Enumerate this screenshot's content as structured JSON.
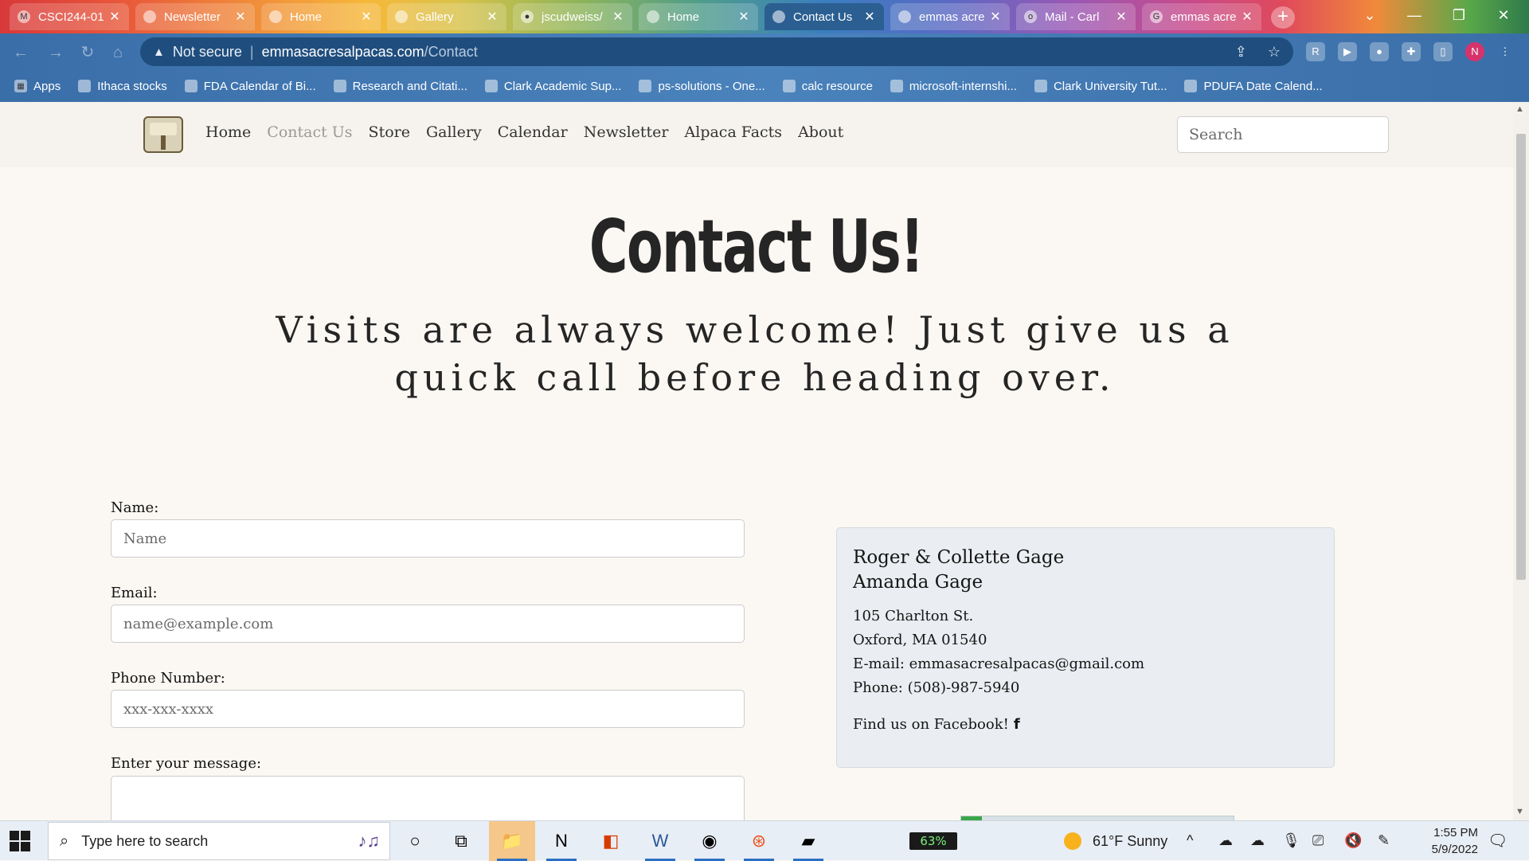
{
  "browser": {
    "tabs": [
      {
        "title": "CSCI244-01",
        "icon": "gmail-icon",
        "active": false
      },
      {
        "title": "Newsletter",
        "icon": "globe-icon",
        "active": false
      },
      {
        "title": "Home",
        "icon": "globe-icon",
        "active": false
      },
      {
        "title": "Gallery",
        "icon": "globe-icon",
        "active": false
      },
      {
        "title": "jscudweiss/",
        "icon": "github-icon",
        "active": false
      },
      {
        "title": "Home",
        "icon": "globe-icon",
        "active": false
      },
      {
        "title": "Contact Us",
        "icon": "globe-icon",
        "active": true
      },
      {
        "title": "emmas acre",
        "icon": "globe-icon",
        "active": false
      },
      {
        "title": "Mail - Carl",
        "icon": "outlook-icon",
        "active": false
      },
      {
        "title": "emmas acre",
        "icon": "google-icon",
        "active": false
      }
    ],
    "address": {
      "security": "Not secure",
      "host": "emmasacresalpacas.com",
      "path": "/Contact"
    },
    "bookmarks": [
      {
        "label": "Apps",
        "icon": "apps-grid-icon"
      },
      {
        "label": "Ithaca stocks",
        "icon": "bookmark-icon"
      },
      {
        "label": "FDA Calendar of Bi...",
        "icon": "bookmark-icon"
      },
      {
        "label": "Research and Citati...",
        "icon": "bookmark-icon"
      },
      {
        "label": "Clark Academic Sup...",
        "icon": "bookmark-icon"
      },
      {
        "label": "ps-solutions - One...",
        "icon": "onedrive-icon"
      },
      {
        "label": "calc resource",
        "icon": "globe-icon"
      },
      {
        "label": "microsoft-internshi...",
        "icon": "github-icon"
      },
      {
        "label": "Clark University Tut...",
        "icon": "bookmark-icon"
      },
      {
        "label": "PDUFA Date Calend...",
        "icon": "bookmark-icon"
      }
    ],
    "profile_initial": "N"
  },
  "site": {
    "nav": [
      {
        "label": "Home",
        "current": false
      },
      {
        "label": "Contact Us",
        "current": true
      },
      {
        "label": "Store",
        "current": false
      },
      {
        "label": "Gallery",
        "current": false
      },
      {
        "label": "Calendar",
        "current": false
      },
      {
        "label": "Newsletter",
        "current": false
      },
      {
        "label": "Alpaca Facts",
        "current": false
      },
      {
        "label": "About",
        "current": false
      }
    ],
    "search_placeholder": "Search",
    "title": "Contact Us!",
    "subtitle": "Visits are always welcome! Just give us a quick call before heading over.",
    "form": {
      "name_label": "Name:",
      "name_placeholder": "Name",
      "email_label": "Email:",
      "email_placeholder": "name@example.com",
      "phone_label": "Phone Number:",
      "phone_placeholder": "xxx-xxx-xxxx",
      "message_label": "Enter your message:"
    },
    "contact": {
      "name1": "Roger & Collette Gage",
      "name2": "Amanda Gage",
      "street": "105 Charlton St.",
      "city": "Oxford, MA 01540",
      "email": "E-mail: emmasacresalpacas@gmail.com",
      "phone": "Phone: (508)-987-5940",
      "facebook": "Find us on Facebook!"
    }
  },
  "taskbar": {
    "search_placeholder": "Type here to search",
    "battery": "63%",
    "weather": "61°F  Sunny",
    "time": "1:55 PM",
    "date": "5/9/2022"
  }
}
